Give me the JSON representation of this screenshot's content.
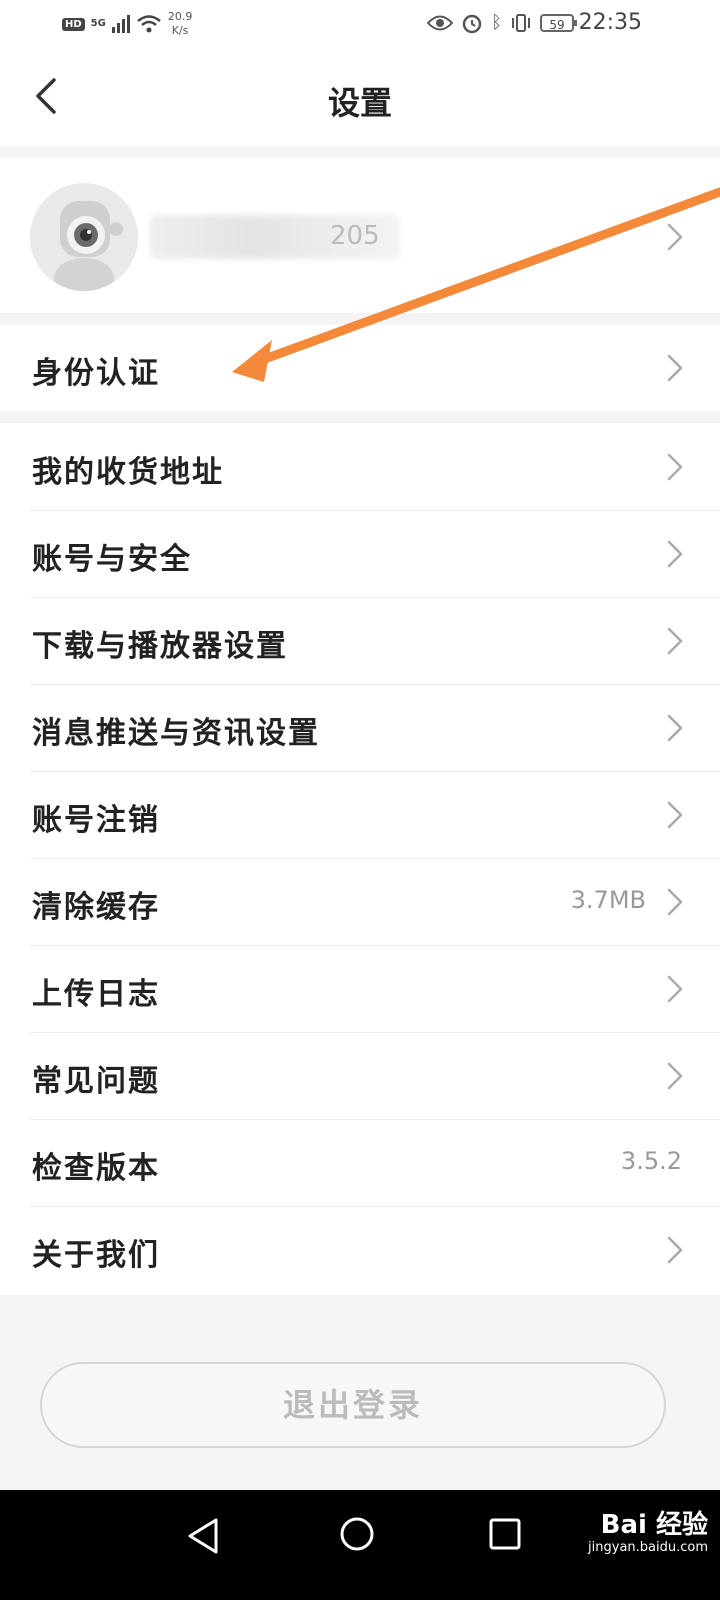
{
  "status_bar": {
    "hd": "HD",
    "network": "5G",
    "speed_value": "20.9",
    "speed_unit": "K/s",
    "battery": "59",
    "time": "22:35",
    "icons": [
      "eye-icon",
      "alarm-icon",
      "bluetooth-icon",
      "vibrate-icon",
      "battery-icon"
    ]
  },
  "header": {
    "title": "设置",
    "back_icon": "chevron-left-icon"
  },
  "profile": {
    "username_visible": "205",
    "avatar_icon": "mascot-avatar"
  },
  "identity_section": {
    "label": "身份认证"
  },
  "menu": {
    "items": [
      {
        "label": "我的收货地址",
        "value": ""
      },
      {
        "label": "账号与安全",
        "value": ""
      },
      {
        "label": "下载与播放器设置",
        "value": ""
      },
      {
        "label": "消息推送与资讯设置",
        "value": ""
      },
      {
        "label": "账号注销",
        "value": ""
      },
      {
        "label": "清除缓存",
        "value": "3.7MB"
      },
      {
        "label": "上传日志",
        "value": ""
      },
      {
        "label": "常见问题",
        "value": ""
      },
      {
        "label": "检查版本",
        "value": "3.5.2"
      },
      {
        "label": "关于我们",
        "value": ""
      }
    ]
  },
  "logout_button": "退出登录",
  "watermark": {
    "brand": "Bai 经验",
    "url": "jingyan.baidu.com"
  },
  "colors": {
    "annotation_arrow": "#f5893a",
    "background": "#f4f4f4",
    "text": "#222222",
    "muted": "#999999"
  }
}
